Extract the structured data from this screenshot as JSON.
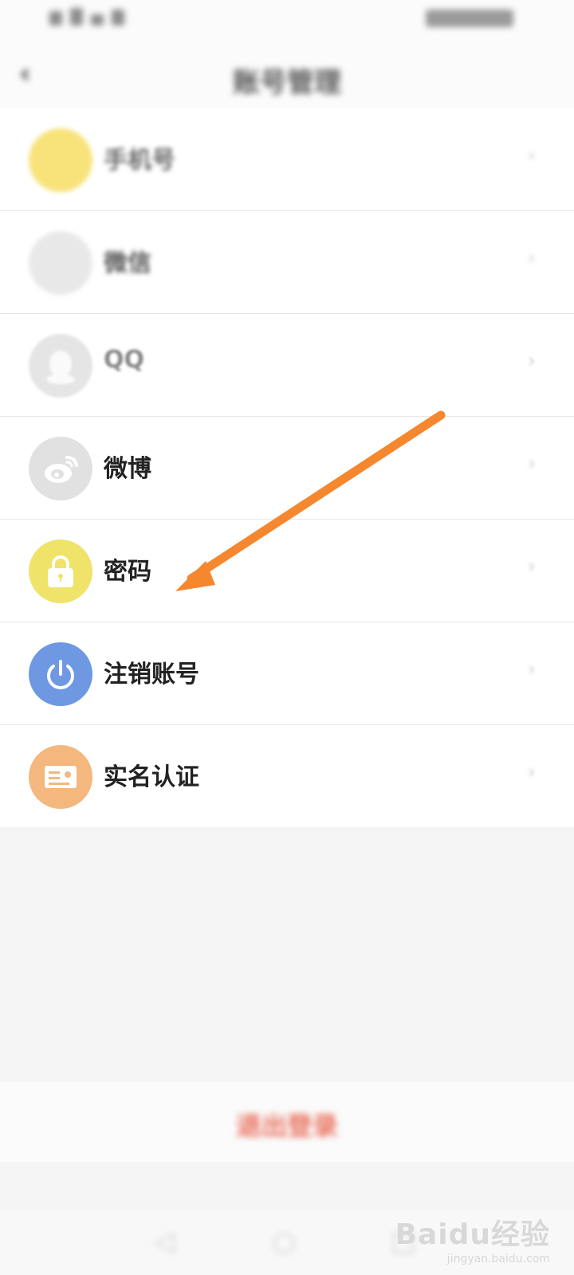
{
  "status_bar": {
    "battery_text": ""
  },
  "header": {
    "title": "账号管理"
  },
  "rows": [
    {
      "name": "账号-row",
      "label": "手机号",
      "sub": "",
      "value": "",
      "icon": "phone-icon",
      "color": "#f7e37a"
    },
    {
      "name": "wechat-row",
      "label": "微信",
      "sub": "",
      "value": "",
      "icon": "wechat-icon",
      "color": "#e8e8e8"
    },
    {
      "name": "qq-row",
      "label": "QQ",
      "sub": "",
      "value": "",
      "icon": "qq-icon",
      "color": "#e5e5e5"
    },
    {
      "name": "weibo-row",
      "label": "微博",
      "sub": "",
      "value": "",
      "icon": "weibo-icon",
      "color": "#e1e1e1"
    },
    {
      "name": "password-row",
      "label": "密码",
      "sub": "",
      "value": "",
      "icon": "lock-icon",
      "color": "#f0e36a"
    },
    {
      "name": "cancel-account-row",
      "label": "注销账号",
      "sub": "",
      "value": "",
      "icon": "power-icon",
      "color": "#6e98e2"
    },
    {
      "name": "real-name-row",
      "label": "实名认证",
      "sub": "",
      "value": "",
      "icon": "id-card-icon",
      "color": "#f4b77e"
    }
  ],
  "logout": {
    "label": "退出登录"
  },
  "watermark": {
    "main": "Baidu经验",
    "sub": "jingyan.baidu.com"
  },
  "annotation": {
    "arrow_color": "#f5872e"
  }
}
